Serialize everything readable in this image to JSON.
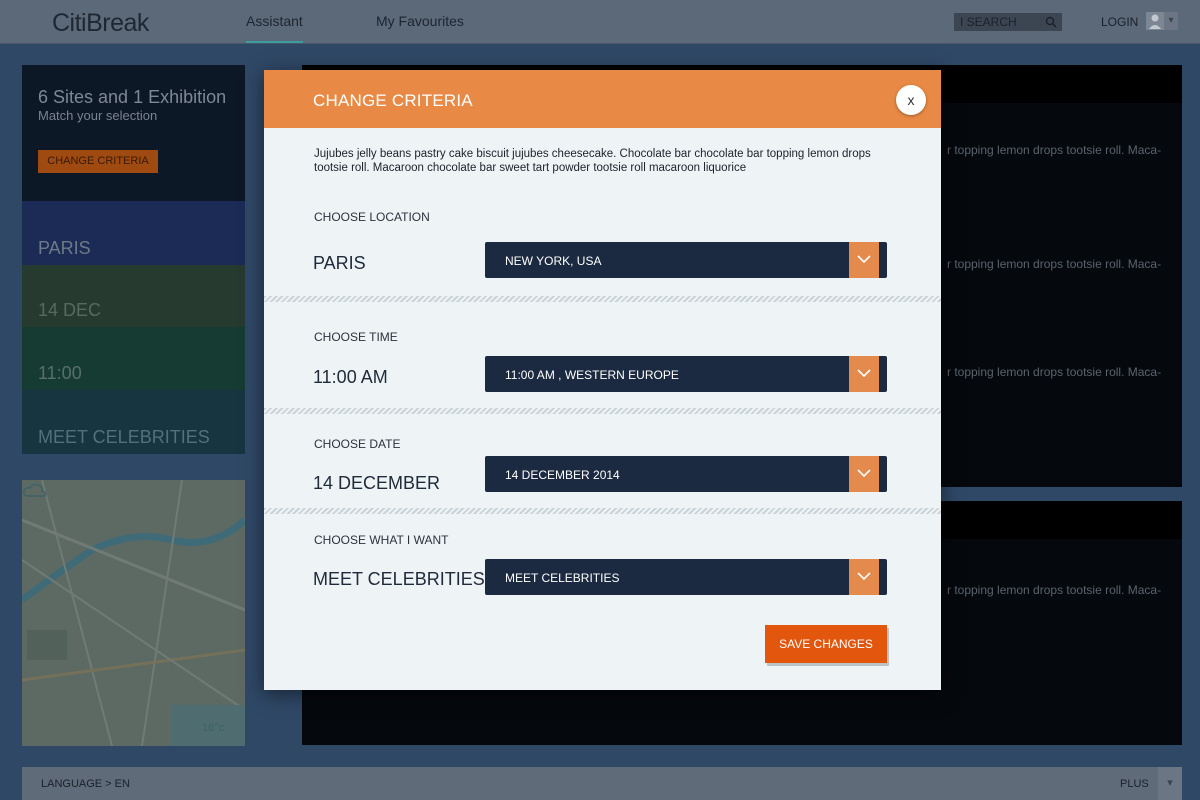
{
  "header": {
    "logo": "CitiBreak",
    "tabs": [
      {
        "label": "Assistant",
        "active": true
      },
      {
        "label": "My Favourites",
        "active": false
      }
    ],
    "search_label": "I SEARCH",
    "login_label": "LOGIN"
  },
  "sidebar": {
    "summary_title": "6 Sites and 1 Exhibition",
    "summary_sub": "Match your selection",
    "change_button": "CHANGE CRITERIA",
    "criteria": [
      "PARIS",
      "14 DEC",
      "11:00",
      "MEET CELEBRITIES"
    ],
    "weather": "16°c"
  },
  "content": {
    "snippet": "r topping lemon drops tootsie roll. Maca-"
  },
  "footer": {
    "language": "LANGUAGE > EN",
    "plus": "PLUS"
  },
  "modal": {
    "title": "CHANGE CRITERIA",
    "close_label": "x",
    "intro": "Jujubes jelly beans pastry cake biscuit jujubes cheesecake. Chocolate bar chocolate bar topping lemon drops tootsie roll. Macaroon chocolate bar sweet tart powder tootsie roll macaroon liquorice",
    "sections": [
      {
        "label": "CHOOSE LOCATION",
        "value": "PARIS",
        "select": "NEW YORK, USA"
      },
      {
        "label": "CHOOSE TIME",
        "value": "11:00 AM",
        "select": "11:00 AM , WESTERN EUROPE"
      },
      {
        "label": "CHOOSE DATE",
        "value": "14 DECEMBER",
        "select": "14 DECEMBER 2014"
      },
      {
        "label": "CHOOSE WHAT I WANT",
        "value": "MEET CELEBRITIES",
        "select": "MEET CELEBRITIES"
      }
    ],
    "save_button": "SAVE CHANGES"
  },
  "colors": {
    "accent": "#e88a45",
    "save": "#e2560d",
    "select_bg": "#1b2a40"
  }
}
